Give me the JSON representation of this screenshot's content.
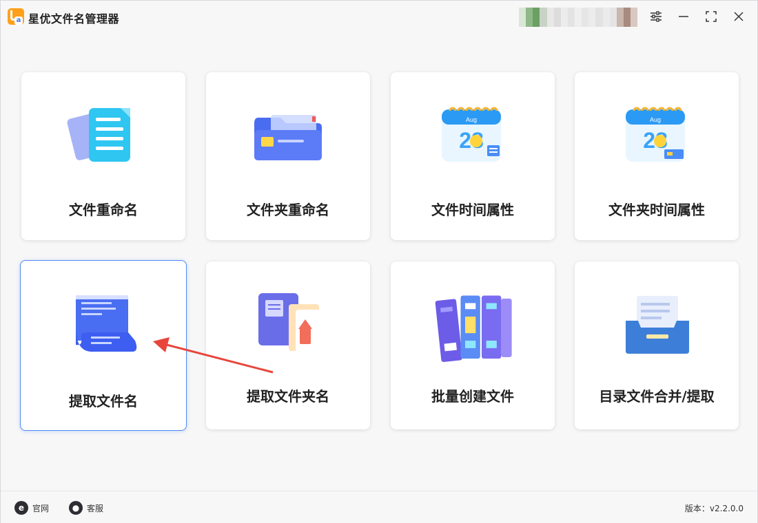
{
  "app": {
    "title": "星优文件名管理器",
    "icon": "app-logo-icon"
  },
  "window_controls": [
    "settings-icon",
    "minimize-icon",
    "maximize-icon",
    "close-icon"
  ],
  "tiles": [
    {
      "label": "文件重命名",
      "icon": "documents-icon"
    },
    {
      "label": "文件夹重命名",
      "icon": "folder-icon"
    },
    {
      "label": "文件时间属性",
      "icon": "calendar-icon",
      "calendar_month": "Aug",
      "calendar_day": "28"
    },
    {
      "label": "文件夹时间属性",
      "icon": "calendar-folder-icon",
      "calendar_month": "Aug",
      "calendar_day": "28"
    },
    {
      "label": "提取文件名",
      "icon": "scroll-document-icon",
      "selected": true
    },
    {
      "label": "提取文件夹名",
      "icon": "book-folder-icon"
    },
    {
      "label": "批量创建文件",
      "icon": "binders-icon"
    },
    {
      "label": "目录文件合并/提取",
      "icon": "file-drawer-icon"
    }
  ],
  "footer": {
    "website_label": "官网",
    "support_label": "客服",
    "version_label": "版本：v2.2.0.0"
  },
  "colors": {
    "accent": "#4f8bf2",
    "arrow": "#e8453c",
    "logo": "#ff9f1a"
  }
}
